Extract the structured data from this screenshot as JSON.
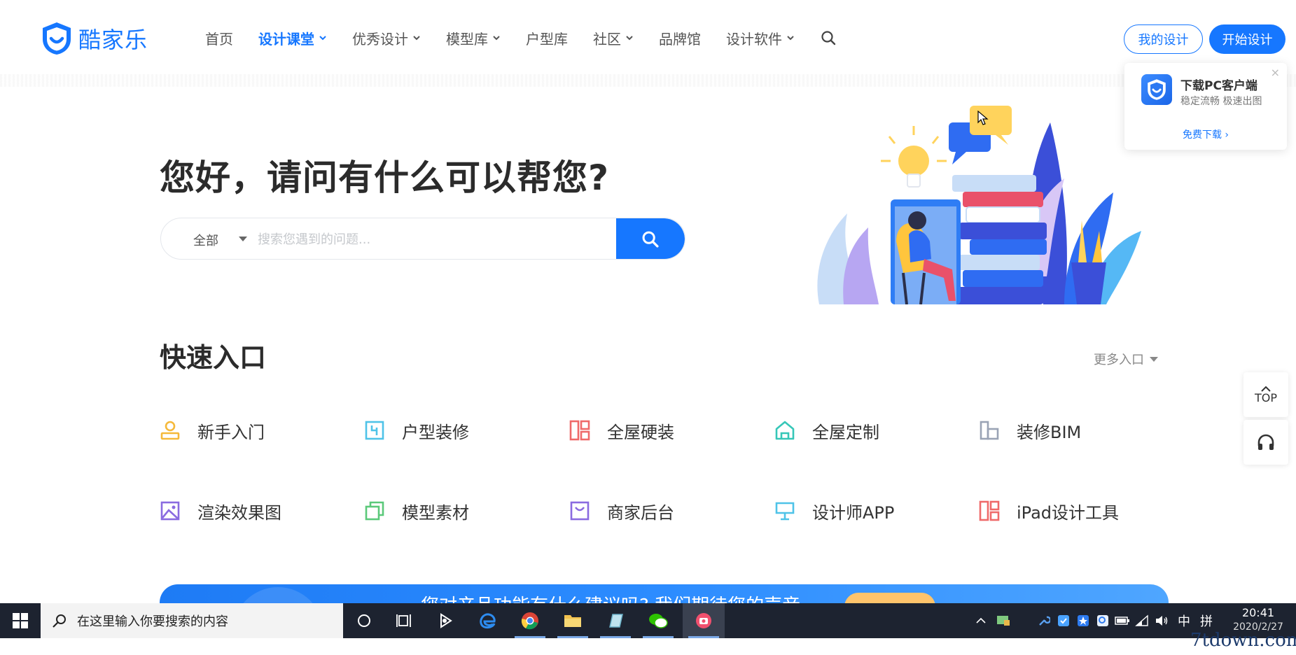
{
  "header": {
    "logo_text": "酷家乐",
    "nav": [
      {
        "label": "首页",
        "active": false,
        "dropdown": false
      },
      {
        "label": "设计课堂",
        "active": true,
        "dropdown": true
      },
      {
        "label": "优秀设计",
        "active": false,
        "dropdown": true
      },
      {
        "label": "模型库",
        "active": false,
        "dropdown": true
      },
      {
        "label": "户型库",
        "active": false,
        "dropdown": false
      },
      {
        "label": "社区",
        "active": false,
        "dropdown": true
      },
      {
        "label": "品牌馆",
        "active": false,
        "dropdown": false
      },
      {
        "label": "设计软件",
        "active": false,
        "dropdown": true
      }
    ],
    "my_design_label": "我的设计",
    "start_design_label": "开始设计"
  },
  "popup": {
    "close": "×",
    "title": "下载PC客户端",
    "subtitle": "稳定流畅 极速出图",
    "link": "免费下载 ›"
  },
  "hero": {
    "title": "您好，请问有什么可以帮您?",
    "search_category": "全部",
    "search_placeholder": "搜索您遇到的问题..."
  },
  "quick": {
    "title": "快速入口",
    "more_label": "更多入口",
    "entries": [
      {
        "label": "新手入门",
        "icon": "user-icon",
        "color": "#f5b93a"
      },
      {
        "label": "户型装修",
        "icon": "floorplan-icon",
        "color": "#4fc3e8"
      },
      {
        "label": "全屋硬装",
        "icon": "layout-icon",
        "color": "#ef6a6a"
      },
      {
        "label": "全屋定制",
        "icon": "house-icon",
        "color": "#36c7b8"
      },
      {
        "label": "装修BIM",
        "icon": "bim-icon",
        "color": "#9aa3b5"
      },
      {
        "label": "渲染效果图",
        "icon": "image-icon",
        "color": "#8a6be0"
      },
      {
        "label": "模型素材",
        "icon": "model-icon",
        "color": "#5bc97a"
      },
      {
        "label": "商家后台",
        "icon": "shop-icon",
        "color": "#8a6be0"
      },
      {
        "label": "设计师APP",
        "icon": "lamp-icon",
        "color": "#4fc3e8"
      },
      {
        "label": "iPad设计工具",
        "icon": "layout-icon",
        "color": "#ef6a6a"
      }
    ]
  },
  "banner": {
    "text": "您对产品功能有什么建议吗? 我们期待您的声音"
  },
  "side": {
    "top_label": "TOP"
  },
  "taskbar": {
    "search_placeholder": "在这里输入你要搜索的内容",
    "ime_label": "中",
    "ime2_label": "拼",
    "time": "20:41",
    "date": "2020/2/27"
  },
  "watermark": "7tdown.com",
  "colors": {
    "brand": "#1677ff",
    "taskbar": "#1d2330"
  }
}
